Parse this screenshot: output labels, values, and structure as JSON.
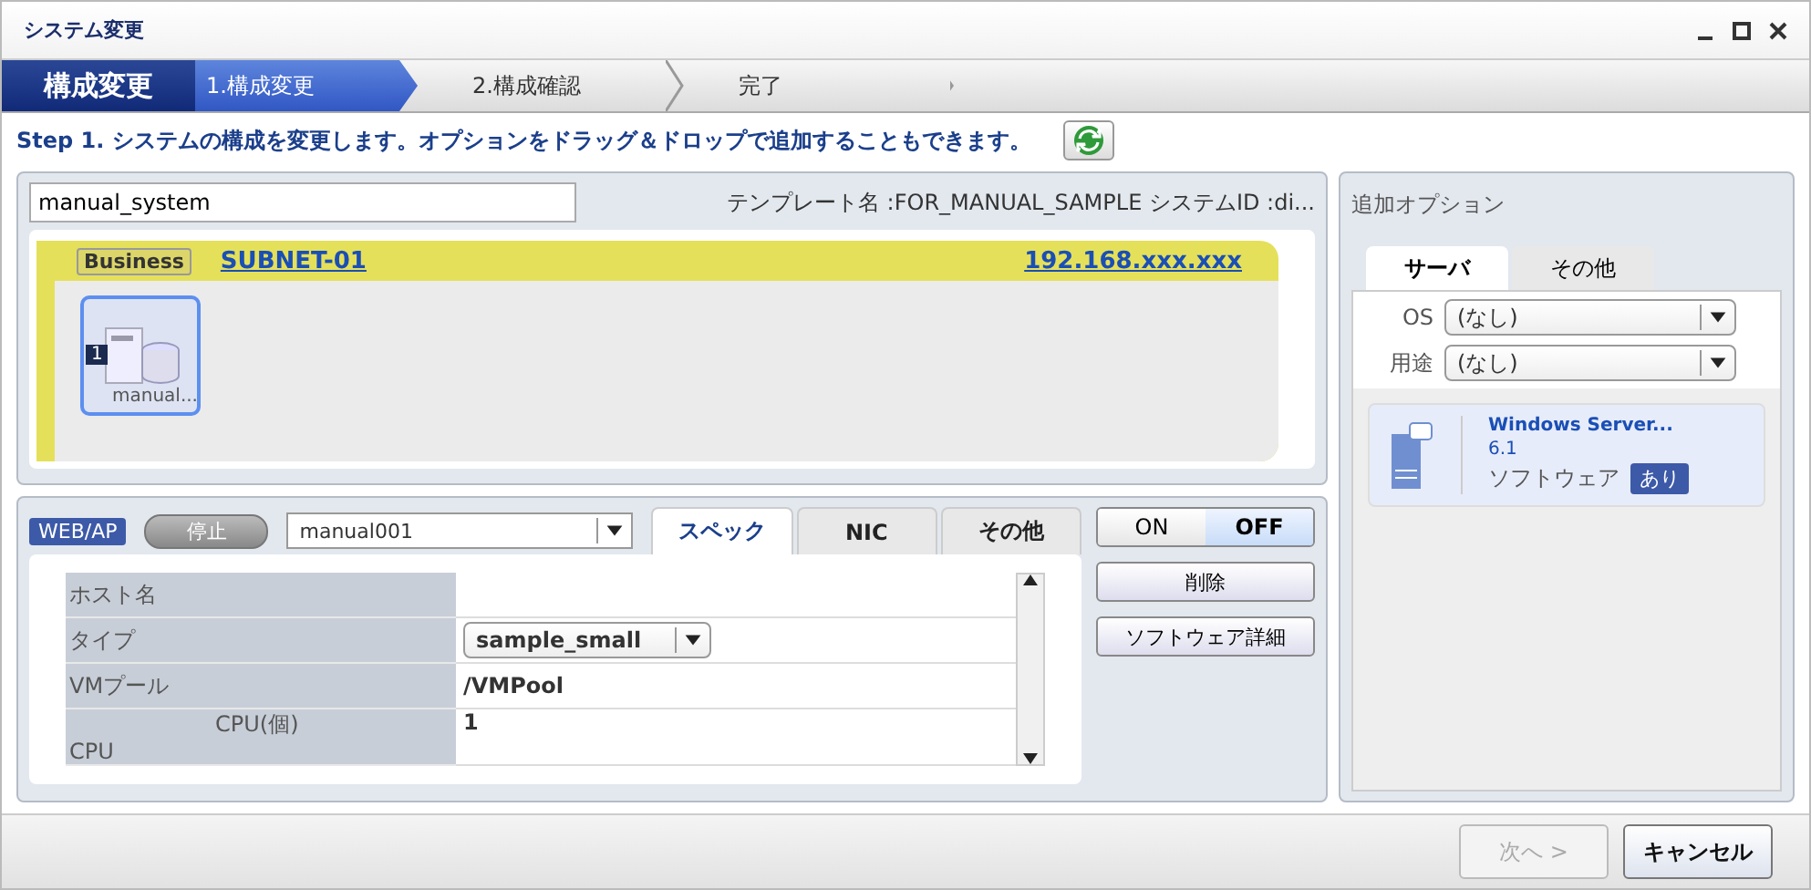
{
  "window": {
    "title": "システム変更"
  },
  "wizard": {
    "heading": "構成変更",
    "steps": [
      {
        "label": "1.構成変更",
        "selected": true
      },
      {
        "label": "2.構成確認",
        "selected": false
      },
      {
        "label": "完了",
        "selected": false
      }
    ]
  },
  "instruction": {
    "text": "Step 1. システムの構成を変更します。オプションをドラッグ＆ドロップで追加することもできます。"
  },
  "system": {
    "name_value": "manual_system",
    "template_info": "テンプレート名 :FOR_MANUAL_SAMPLE  システムID :di..."
  },
  "subnet": {
    "tag": "Business",
    "name": "SUBNET-01",
    "address": "192.168.xxx.xxx",
    "servers": [
      {
        "count": "1",
        "label": "manual...",
        "selected": true
      }
    ]
  },
  "server_detail": {
    "role": "WEB/AP",
    "status": "停止",
    "server_value": "manual001",
    "tabs": [
      {
        "label": "スペック",
        "selected": true
      },
      {
        "label": "NIC",
        "selected": false
      },
      {
        "label": "その他",
        "selected": false
      }
    ],
    "rows": [
      {
        "kind": "text",
        "label": "ホスト名"
      },
      {
        "kind": "select",
        "label": "タイプ",
        "value": "sample_small"
      },
      {
        "kind": "text",
        "label": "VMプール",
        "value": "/VMPool"
      },
      {
        "kind": "group",
        "label": "CPU",
        "sublabel": "CPU(個)",
        "value": "1"
      }
    ],
    "power": [
      {
        "label": "ON",
        "selected": false
      },
      {
        "label": "OFF",
        "selected": true
      }
    ],
    "buttons": [
      "削除",
      "ソフトウェア詳細"
    ]
  },
  "options": {
    "title": "追加オプション",
    "tabs": [
      {
        "label": "サーバ",
        "selected": true
      },
      {
        "label": "その他",
        "selected": false
      }
    ],
    "filters": [
      {
        "label": "OS",
        "value": "(なし)"
      },
      {
        "label": "用途",
        "value": "(なし)"
      }
    ],
    "items": [
      {
        "name": "Windows Server...",
        "version": "6.1",
        "type_label": "ソフトウェア",
        "badge": "あり"
      }
    ]
  },
  "footer": {
    "buttons": [
      {
        "label": "次へ >",
        "disabled": true
      },
      {
        "label": "キャンセル",
        "disabled": false
      }
    ]
  }
}
